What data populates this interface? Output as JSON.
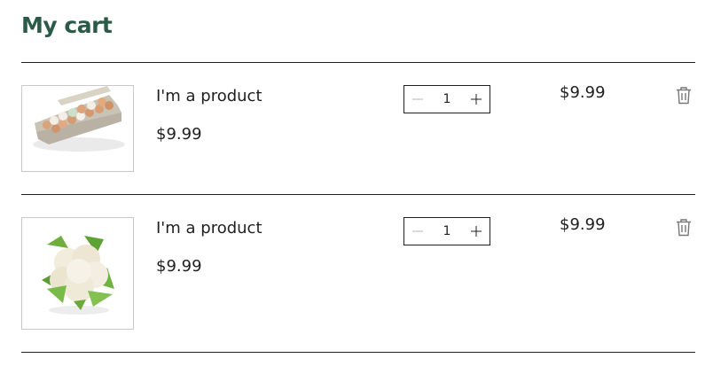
{
  "cart": {
    "title": "My cart",
    "items": [
      {
        "image": "egg-carton",
        "name": "I'm a product",
        "unit_price": "$9.99",
        "quantity": "1",
        "total": "$9.99"
      },
      {
        "image": "cauliflower",
        "name": "I'm a product",
        "unit_price": "$9.99",
        "quantity": "1",
        "total": "$9.99"
      }
    ]
  },
  "icons": {
    "decrease": "minus-icon",
    "increase": "plus-icon",
    "remove": "trash-icon"
  },
  "colors": {
    "title": "#2b5a47",
    "text": "#1f1f1f",
    "icon": "#777777",
    "thumb_border": "#c9c9c9"
  }
}
